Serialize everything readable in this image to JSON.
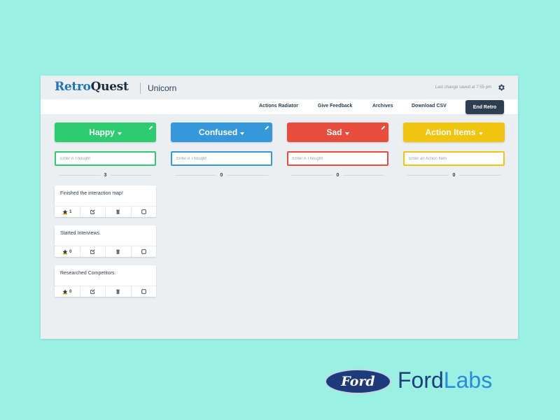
{
  "app": {
    "logo_part1": "Retro",
    "logo_part2": "Quest",
    "team_name": "Unicorn",
    "last_saved": "Last change saved at 7:55 pm"
  },
  "nav": {
    "actions_radiator": "Actions Radiator",
    "give_feedback": "Give Feedback",
    "archives": "Archives",
    "download_csv": "Download CSV",
    "end_retro": "End Retro"
  },
  "columns": [
    {
      "title": "Happy",
      "color": "#2ecc71",
      "placeholder": "Enter A Thought",
      "count": "3",
      "items": [
        {
          "text": "Finished the interaction map!",
          "votes": "1"
        },
        {
          "text": "Started Interviews.",
          "votes": "0"
        },
        {
          "text": "Researched Competitors.",
          "votes": "0"
        }
      ]
    },
    {
      "title": "Confused",
      "color": "#3498db",
      "placeholder": "Enter A Thought",
      "count": "0",
      "items": []
    },
    {
      "title": "Sad",
      "color": "#e74c3c",
      "placeholder": "Enter A Thought",
      "count": "0",
      "items": []
    },
    {
      "title": "Action Items",
      "color": "#f1c40f",
      "placeholder": "Enter an Action Item",
      "count": "0",
      "items": []
    }
  ],
  "branding": {
    "ford_logo": "Ford",
    "fordlabs_part1": "Ford",
    "fordlabs_part2": "Labs"
  },
  "icons": [
    "gear-icon",
    "pencil-icon",
    "caret-down-icon",
    "star-icon",
    "edit-icon",
    "trash-icon",
    "checkbox-icon"
  ]
}
